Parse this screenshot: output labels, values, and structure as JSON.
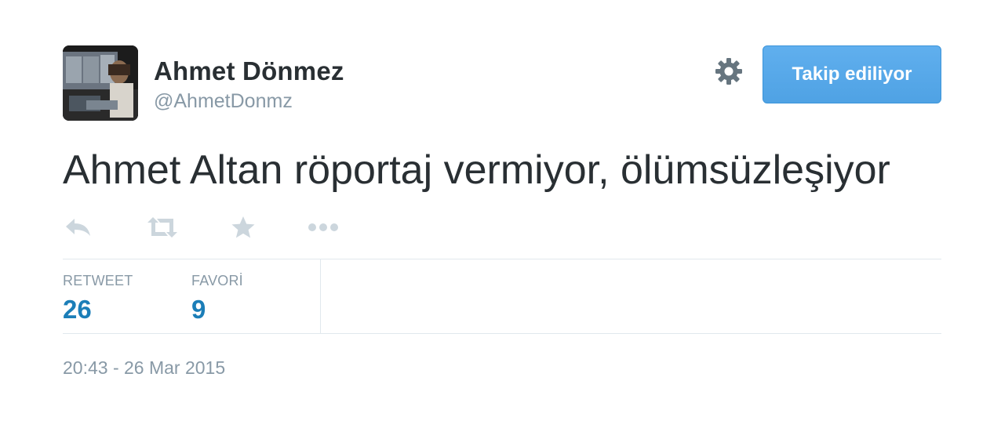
{
  "user": {
    "full_name": "Ahmet Dönmez",
    "screen_name": "@AhmetDonmz"
  },
  "follow_button": {
    "label": "Takip ediliyor"
  },
  "tweet": {
    "text": "Ahmet Altan röportaj vermiyor, ölümsüzleşiyor",
    "timestamp": "20:43 - 26 Mar 2015"
  },
  "actions": [
    {
      "icon": "reply-icon"
    },
    {
      "icon": "retweet-icon"
    },
    {
      "icon": "favorite-star-icon"
    },
    {
      "icon": "more-dots-icon"
    }
  ],
  "stats": {
    "retweet_label": "RETWEET",
    "retweet_count": "26",
    "favorite_label": "FAVORİ",
    "favorite_count": "9"
  },
  "colors": {
    "link_blue": "#1b7eb8",
    "button_blue": "#55acee",
    "muted_text": "#8899a6",
    "icon_gray": "#ccd6dd",
    "gear_gray": "#66757f"
  }
}
